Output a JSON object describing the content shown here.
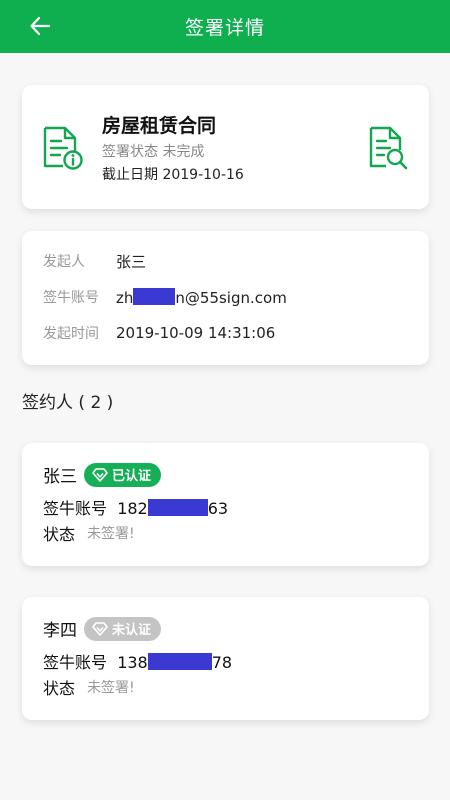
{
  "header": {
    "title": "签署详情"
  },
  "document": {
    "title": "房屋租赁合同",
    "status": "签署状态 未完成",
    "deadline": "截止日期 2019-10-16"
  },
  "info": {
    "initiator_label": "发起人",
    "initiator_value": "张三",
    "account_label": "签牛账号",
    "account_prefix": "zh",
    "account_suffix": "n@55sign.com",
    "time_label": "发起时间",
    "time_value": "2019-10-09 14:31:06"
  },
  "signers_title": "签约人 ( 2 )",
  "signers": [
    {
      "name": "张三",
      "badge": "已认证",
      "account_label": "签牛账号",
      "account_prefix": "182",
      "account_suffix": "63",
      "state_label": "状态",
      "state_value": "未签署!"
    },
    {
      "name": "李四",
      "badge": "未认证",
      "account_label": "签牛账号",
      "account_prefix": "138",
      "account_suffix": "78",
      "state_label": "状态",
      "state_value": "未签署!"
    }
  ],
  "colors": {
    "brand": "#0fae4f",
    "verified": "#16ae57",
    "unverified": "#c4c4c4",
    "redaction": "#3a3ad2"
  },
  "icons": [
    "back-arrow-icon",
    "document-info-icon",
    "document-search-icon",
    "diamond-icon"
  ]
}
